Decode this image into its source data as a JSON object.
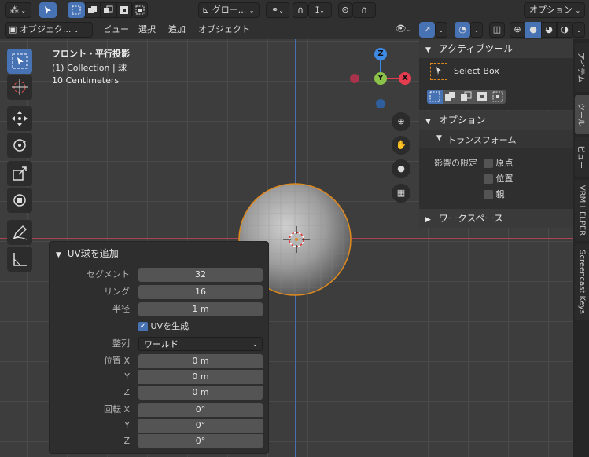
{
  "top_header": {
    "transform_orientation": "グロー...",
    "options_label": "オプション"
  },
  "viewport_header": {
    "mode": "オブジェク...",
    "menus": [
      "ビュー",
      "選択",
      "追加",
      "オブジェクト"
    ]
  },
  "overlay_text": {
    "view_name": "フロント・平行投影",
    "collection": "(1) Collection | 球",
    "scale": "10 Centimeters"
  },
  "gizmo": {
    "z_label": "Z",
    "y_label": "Y",
    "x_label": "X",
    "colors": {
      "x": "#e63c4f",
      "y": "#8ac24a",
      "z": "#3e8ae5"
    }
  },
  "npanel": {
    "active_tool_header": "アクティブツール",
    "tool_name": "Select Box",
    "options_header": "オプション",
    "transform_subheader": "トランスフォーム",
    "affect_only_label": "影響の限定",
    "checkboxes": [
      "原点",
      "位置",
      "親"
    ],
    "workspace_header": "ワークスペース"
  },
  "side_tabs": [
    "アイテム",
    "ツール",
    "ビュー",
    "VRM HELPER",
    "Screencast Keys"
  ],
  "operator_panel": {
    "title": "UV球を追加",
    "segments_label": "セグメント",
    "segments_value": "32",
    "rings_label": "リング",
    "rings_value": "16",
    "radius_label": "半径",
    "radius_value": "1 m",
    "generate_uv_label": "UVを生成",
    "generate_uv_checked": true,
    "align_label": "整列",
    "align_value": "ワールド",
    "location_label": "位置 X",
    "loc_y_label": "Y",
    "loc_z_label": "Z",
    "loc_x_value": "0 m",
    "loc_y_value": "0 m",
    "loc_z_value": "0 m",
    "rotation_label": "回転 X",
    "rot_y_label": "Y",
    "rot_z_label": "Z",
    "rot_x_value": "0°",
    "rot_y_value": "0°",
    "rot_z_value": "0°"
  },
  "colors": {
    "accent": "#4772b3",
    "background": "#3d3d3d"
  }
}
